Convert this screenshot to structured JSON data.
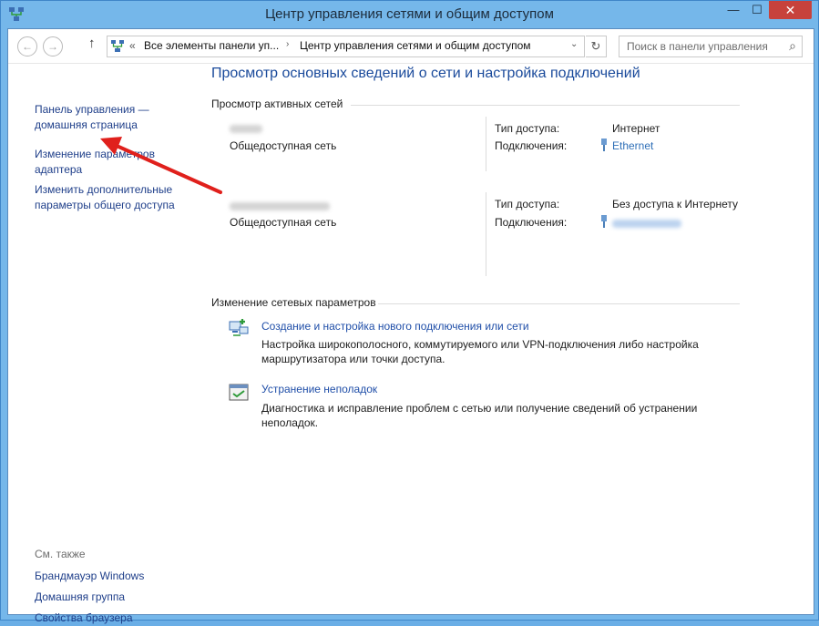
{
  "window": {
    "title": "Центр управления сетями и общим доступом",
    "minimize": "—",
    "maximize": "☐",
    "close": "✕"
  },
  "nav": {
    "back": "←",
    "forward": "→",
    "up": "↑",
    "address_prefix": "«",
    "crumb1": "Все элементы панели уп...",
    "separator": "›",
    "crumb2": "Центр управления сетями и общим доступом",
    "dropdown": "⌄",
    "refresh": "↻",
    "search_placeholder": "Поиск в панели управления",
    "search_glyph": "⌕"
  },
  "sidebar": {
    "home": [
      "Панель управления —",
      "домашняя страница"
    ],
    "adapter": [
      "Изменение параметров",
      "адаптера"
    ],
    "sharing": [
      "Изменить дополнительные",
      "параметры общего доступа"
    ],
    "see_also": "См. также",
    "links": [
      "Брандмауэр Windows",
      "Домашняя группа",
      "Свойства браузера"
    ]
  },
  "main": {
    "title": "Просмотр основных сведений о сети и настройка подключений",
    "active_header": "Просмотр активных сетей",
    "networks": [
      {
        "type": "Общедоступная сеть",
        "access_label": "Тип доступа:",
        "access_value": "Интернет",
        "conn_label": "Подключения:",
        "conn_value": "Ethernet"
      },
      {
        "type": "Общедоступная сеть",
        "access_label": "Тип доступа:",
        "access_value": "Без доступа к Интернету",
        "conn_label": "Подключения:",
        "conn_value": ""
      }
    ],
    "change_header": "Изменение сетевых параметров",
    "tasks": [
      {
        "title": "Создание и настройка нового подключения или сети",
        "desc": "Настройка широкополосного, коммутируемого или VPN-подключения либо настройка маршрутизатора или точки доступа."
      },
      {
        "title": "Устранение неполадок",
        "desc": "Диагностика и исправление проблем с сетью или получение сведений об устранении неполадок."
      }
    ]
  },
  "colors": {
    "link": "#1f3f8a",
    "heading": "#1a4a9b",
    "annotation_arrow": "#e0201c",
    "frame": "#75b7ea"
  }
}
